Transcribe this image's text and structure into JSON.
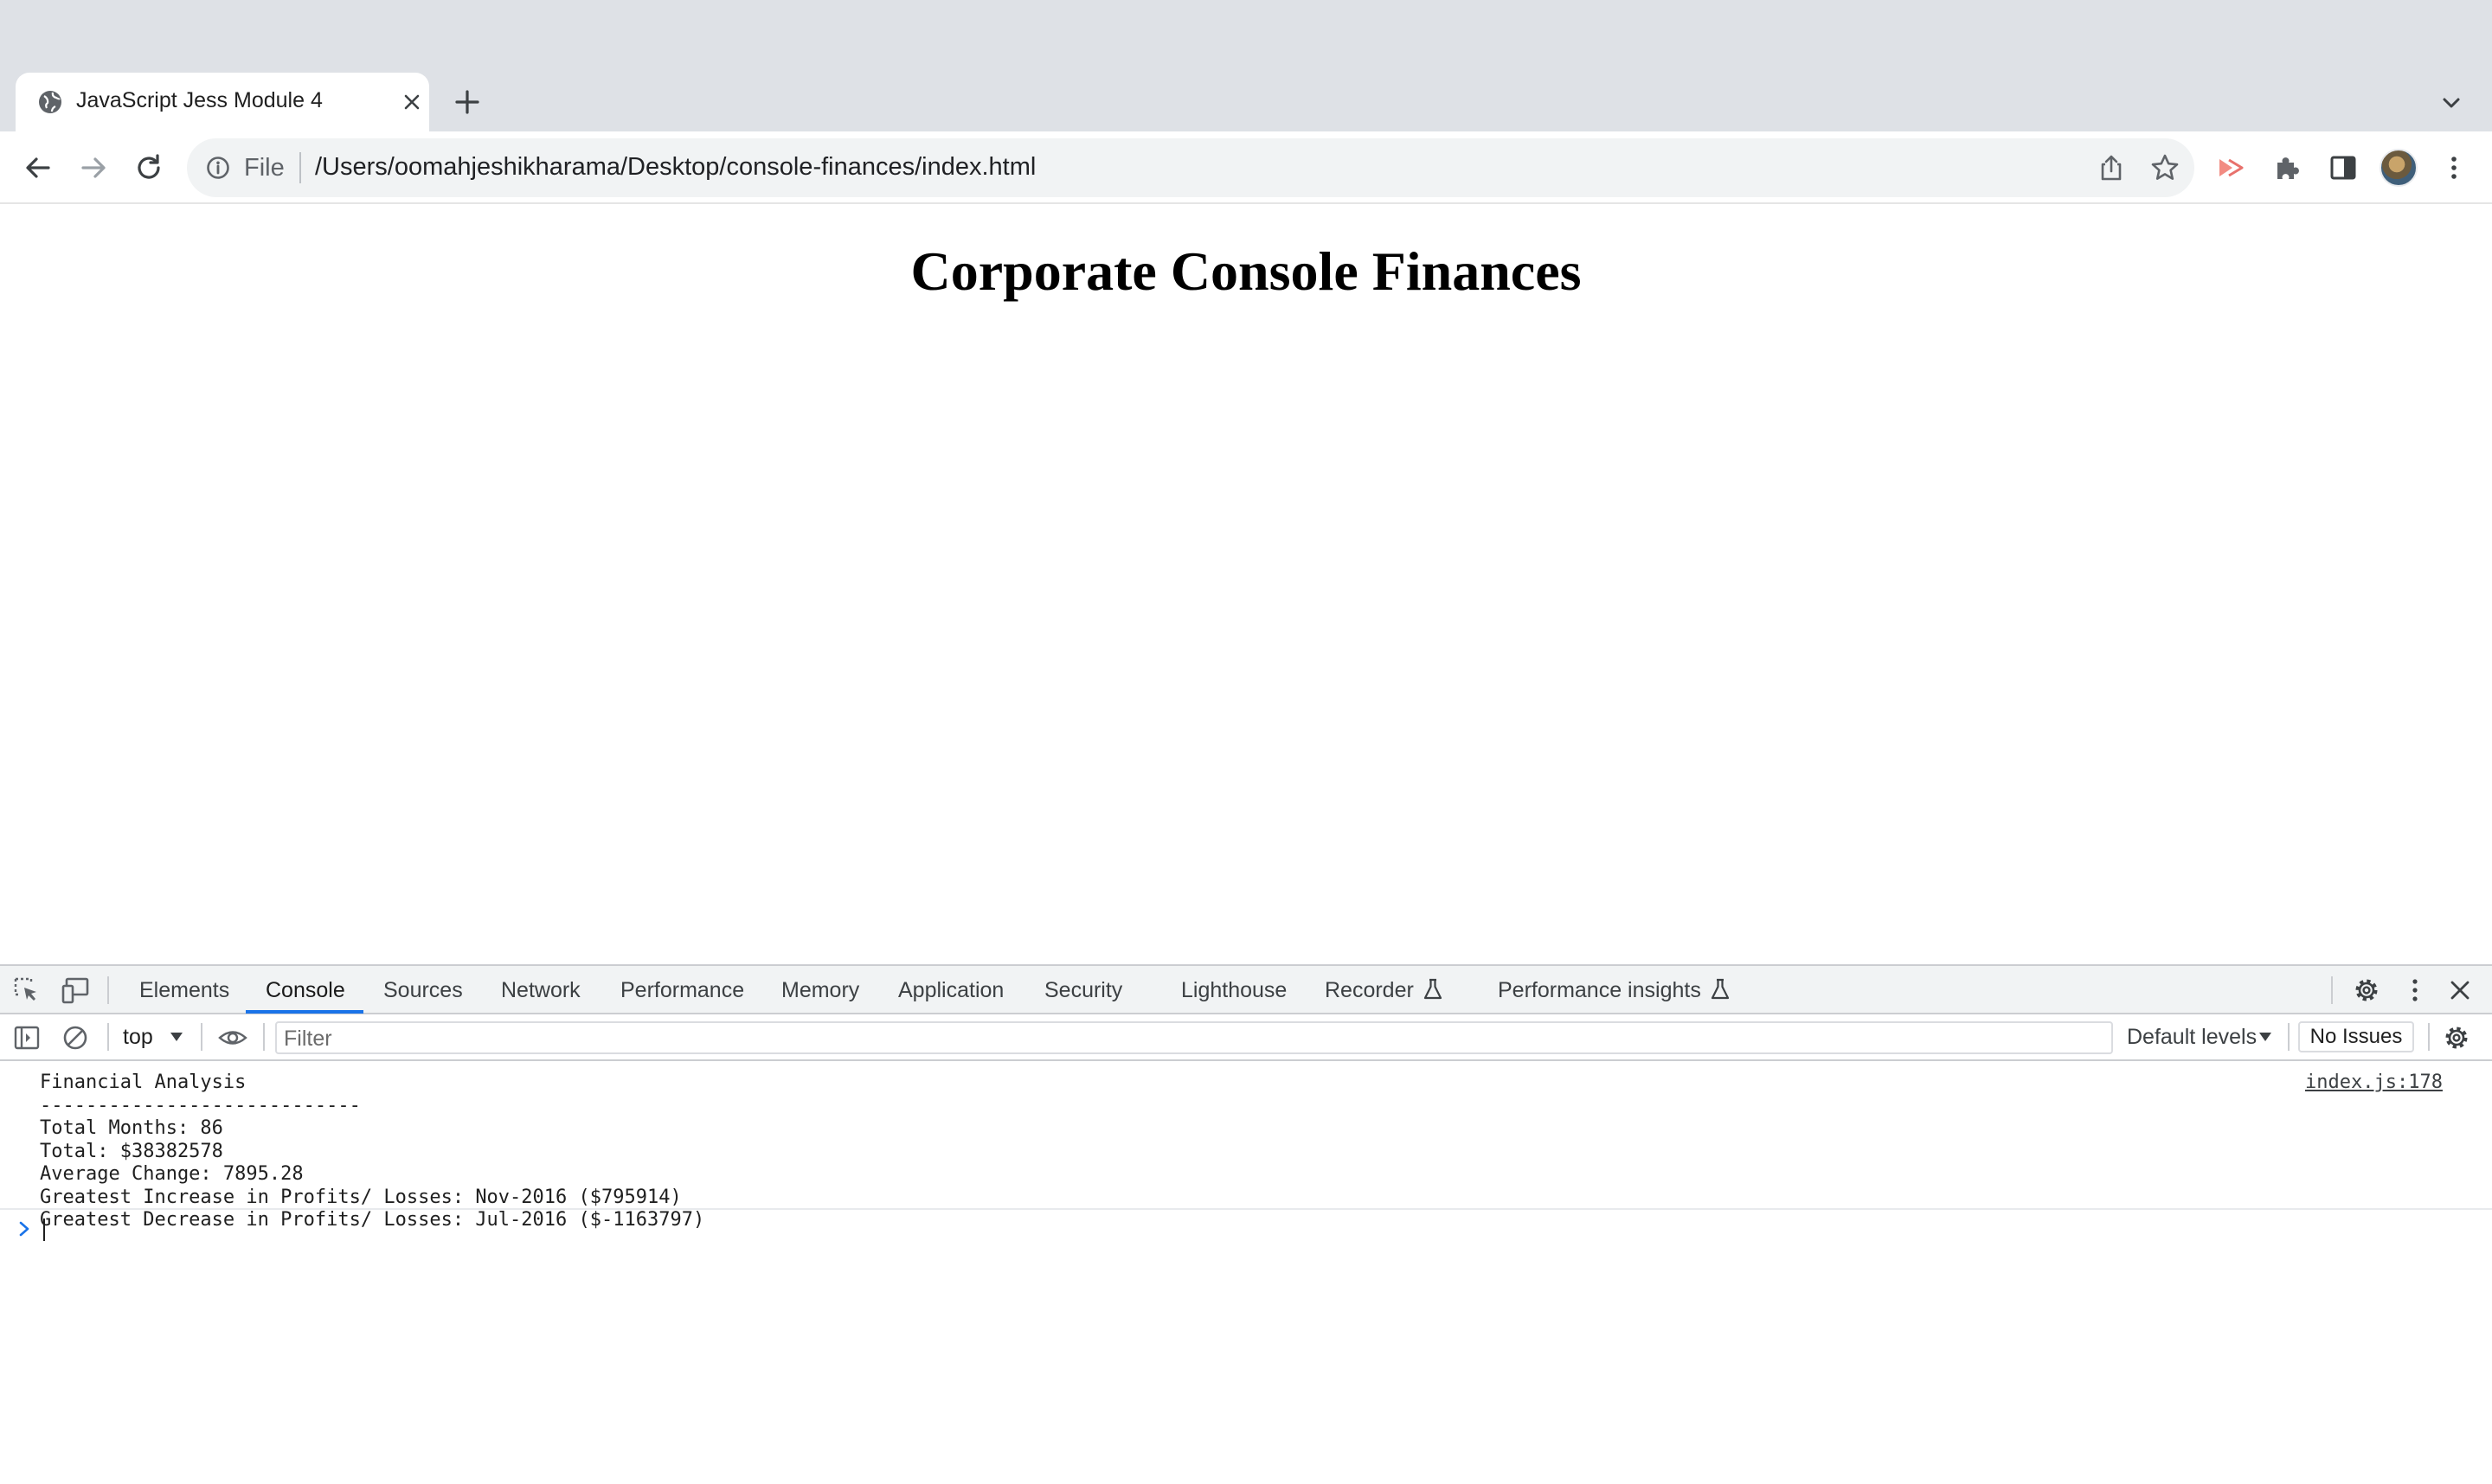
{
  "browser": {
    "tab": {
      "title": "JavaScript Jess Module 4"
    },
    "omnibox": {
      "scheme_label": "File",
      "url": "/Users/oomahjeshikharama/Desktop/console-finances/index.html"
    }
  },
  "page": {
    "heading": "Corporate Console Finances"
  },
  "devtools": {
    "tabs": [
      "Elements",
      "Console",
      "Sources",
      "Network",
      "Performance",
      "Memory",
      "Application",
      "Security",
      "Lighthouse",
      "Recorder",
      "Performance insights"
    ],
    "active_tab": "Console",
    "console_bar": {
      "context": "top",
      "filter_placeholder": "Filter",
      "levels": "Default levels",
      "issues": "No Issues"
    },
    "console": {
      "lines": [
        "Financial Analysis",
        "----------------------------",
        "Total Months: 86",
        "Total: $38382578",
        "Average Change: 7895.28",
        "Greatest Increase in Profits/ Losses: Nov-2016 ($795914)",
        "Greatest Decrease in Profits/ Losses: Jul-2016 ($-1163797)"
      ],
      "source": "index.js:178"
    }
  },
  "colors": {
    "tabstrip_bg": "#dee1e6",
    "accent": "#1a73e8",
    "recorder_icon": "#e8716c"
  },
  "icons": [
    "globe-icon",
    "close-icon",
    "plus-icon",
    "chevron-down-icon",
    "back-icon",
    "forward-icon",
    "reload-icon",
    "info-icon",
    "share-icon",
    "star-icon",
    "recorder-icon",
    "puzzle-icon",
    "side-panel-icon",
    "more-icon",
    "inspect-icon",
    "device-icon",
    "gear-icon",
    "sidebar-icon",
    "clear-icon",
    "eye-icon",
    "flask-icon"
  ]
}
